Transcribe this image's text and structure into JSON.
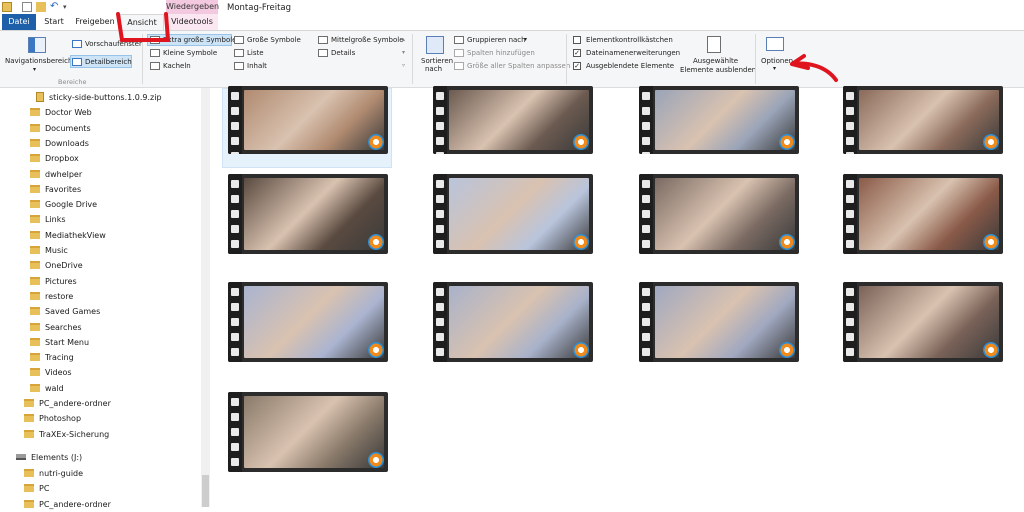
{
  "title_bar": {
    "context_tab_label": "Wiedergeben",
    "window_title": "Montag-Freitag"
  },
  "tabs": [
    {
      "label": "Datei"
    },
    {
      "label": "Start"
    },
    {
      "label": "Freigeben"
    },
    {
      "label": "Ansicht"
    },
    {
      "label": "Videotools"
    }
  ],
  "ribbon": {
    "panes_group": {
      "navigationsbereich": "Navigationsbereich",
      "vorschaufenster": "Vorschaufenster",
      "detailbereich": "Detailbereich",
      "group_label": "Bereiche"
    },
    "layout_group": {
      "items": [
        "Extra große Symbole",
        "Große Symbole",
        "Mittelgroße Symbole",
        "Kleine Symbole",
        "Liste",
        "Details",
        "Kacheln",
        "Inhalt"
      ]
    },
    "current_view_group": {
      "sortieren_line1": "Sortieren",
      "sortieren_line2": "nach",
      "gruppieren": "Gruppieren nach",
      "spalten_hinzufuegen": "Spalten hinzufügen",
      "groesse_anpassen": "Größe aller Spalten anpassen"
    },
    "show_hide_group": {
      "elementkontrollkaestchen": "Elementkontrollkästchen",
      "dateinamenerweiterungen": "Dateinamenerweiterungen",
      "ausgeblendete_elemente": "Ausgeblendete Elemente",
      "ausgewaehlte_line1": "Ausgewählte",
      "ausgewaehlte_line2": "Elemente ausblenden"
    },
    "optionen": "Optionen"
  },
  "nav_items": [
    {
      "label": "sticky-side-buttons.1.0.9.zip",
      "type": "zip"
    },
    {
      "label": "Doctor Web",
      "type": "folder"
    },
    {
      "label": "Documents",
      "type": "folder"
    },
    {
      "label": "Downloads",
      "type": "folder"
    },
    {
      "label": "Dropbox",
      "type": "folder"
    },
    {
      "label": "dwhelper",
      "type": "folder"
    },
    {
      "label": "Favorites",
      "type": "folder"
    },
    {
      "label": "Google Drive",
      "type": "folder"
    },
    {
      "label": "Links",
      "type": "folder"
    },
    {
      "label": "MediathekView",
      "type": "folder"
    },
    {
      "label": "Music",
      "type": "folder"
    },
    {
      "label": "OneDrive",
      "type": "folder"
    },
    {
      "label": "Pictures",
      "type": "folder"
    },
    {
      "label": "restore",
      "type": "folder"
    },
    {
      "label": "Saved Games",
      "type": "folder"
    },
    {
      "label": "Searches",
      "type": "folder"
    },
    {
      "label": "Start Menu",
      "type": "folder"
    },
    {
      "label": "Tracing",
      "type": "folder"
    },
    {
      "label": "Videos",
      "type": "folder"
    },
    {
      "label": "wald",
      "type": "folder"
    },
    {
      "label": "PC_andere-ordner",
      "type": "folder"
    },
    {
      "label": "Photoshop",
      "type": "folder"
    },
    {
      "label": "TraXEx-Sicherung",
      "type": "folder"
    },
    {
      "label": "Elements (J:)",
      "type": "drive"
    },
    {
      "label": "nutri-guide",
      "type": "folder"
    },
    {
      "label": "PC",
      "type": "folder"
    },
    {
      "label": "PC_andere-ordner",
      "type": "folder"
    }
  ],
  "video_thumbnails": [
    {
      "color": "#b08a70"
    },
    {
      "color": "#6b5a50"
    },
    {
      "color": "#9aa4b8"
    },
    {
      "color": "#8a6a5a"
    },
    {
      "color": "#5a4a40"
    },
    {
      "color": "#b8c4dc"
    },
    {
      "color": "#7a6a62"
    },
    {
      "color": "#8a5a48"
    },
    {
      "color": "#aab4d0"
    },
    {
      "color": "#a8b2ca"
    },
    {
      "color": "#a0a8c0"
    },
    {
      "color": "#7a6258"
    },
    {
      "color": "#8a7a6a"
    }
  ],
  "colors": {
    "accent": "#1d5fa8",
    "context_tab": "#f3c9e0",
    "annotation_red": "#e0141e"
  }
}
